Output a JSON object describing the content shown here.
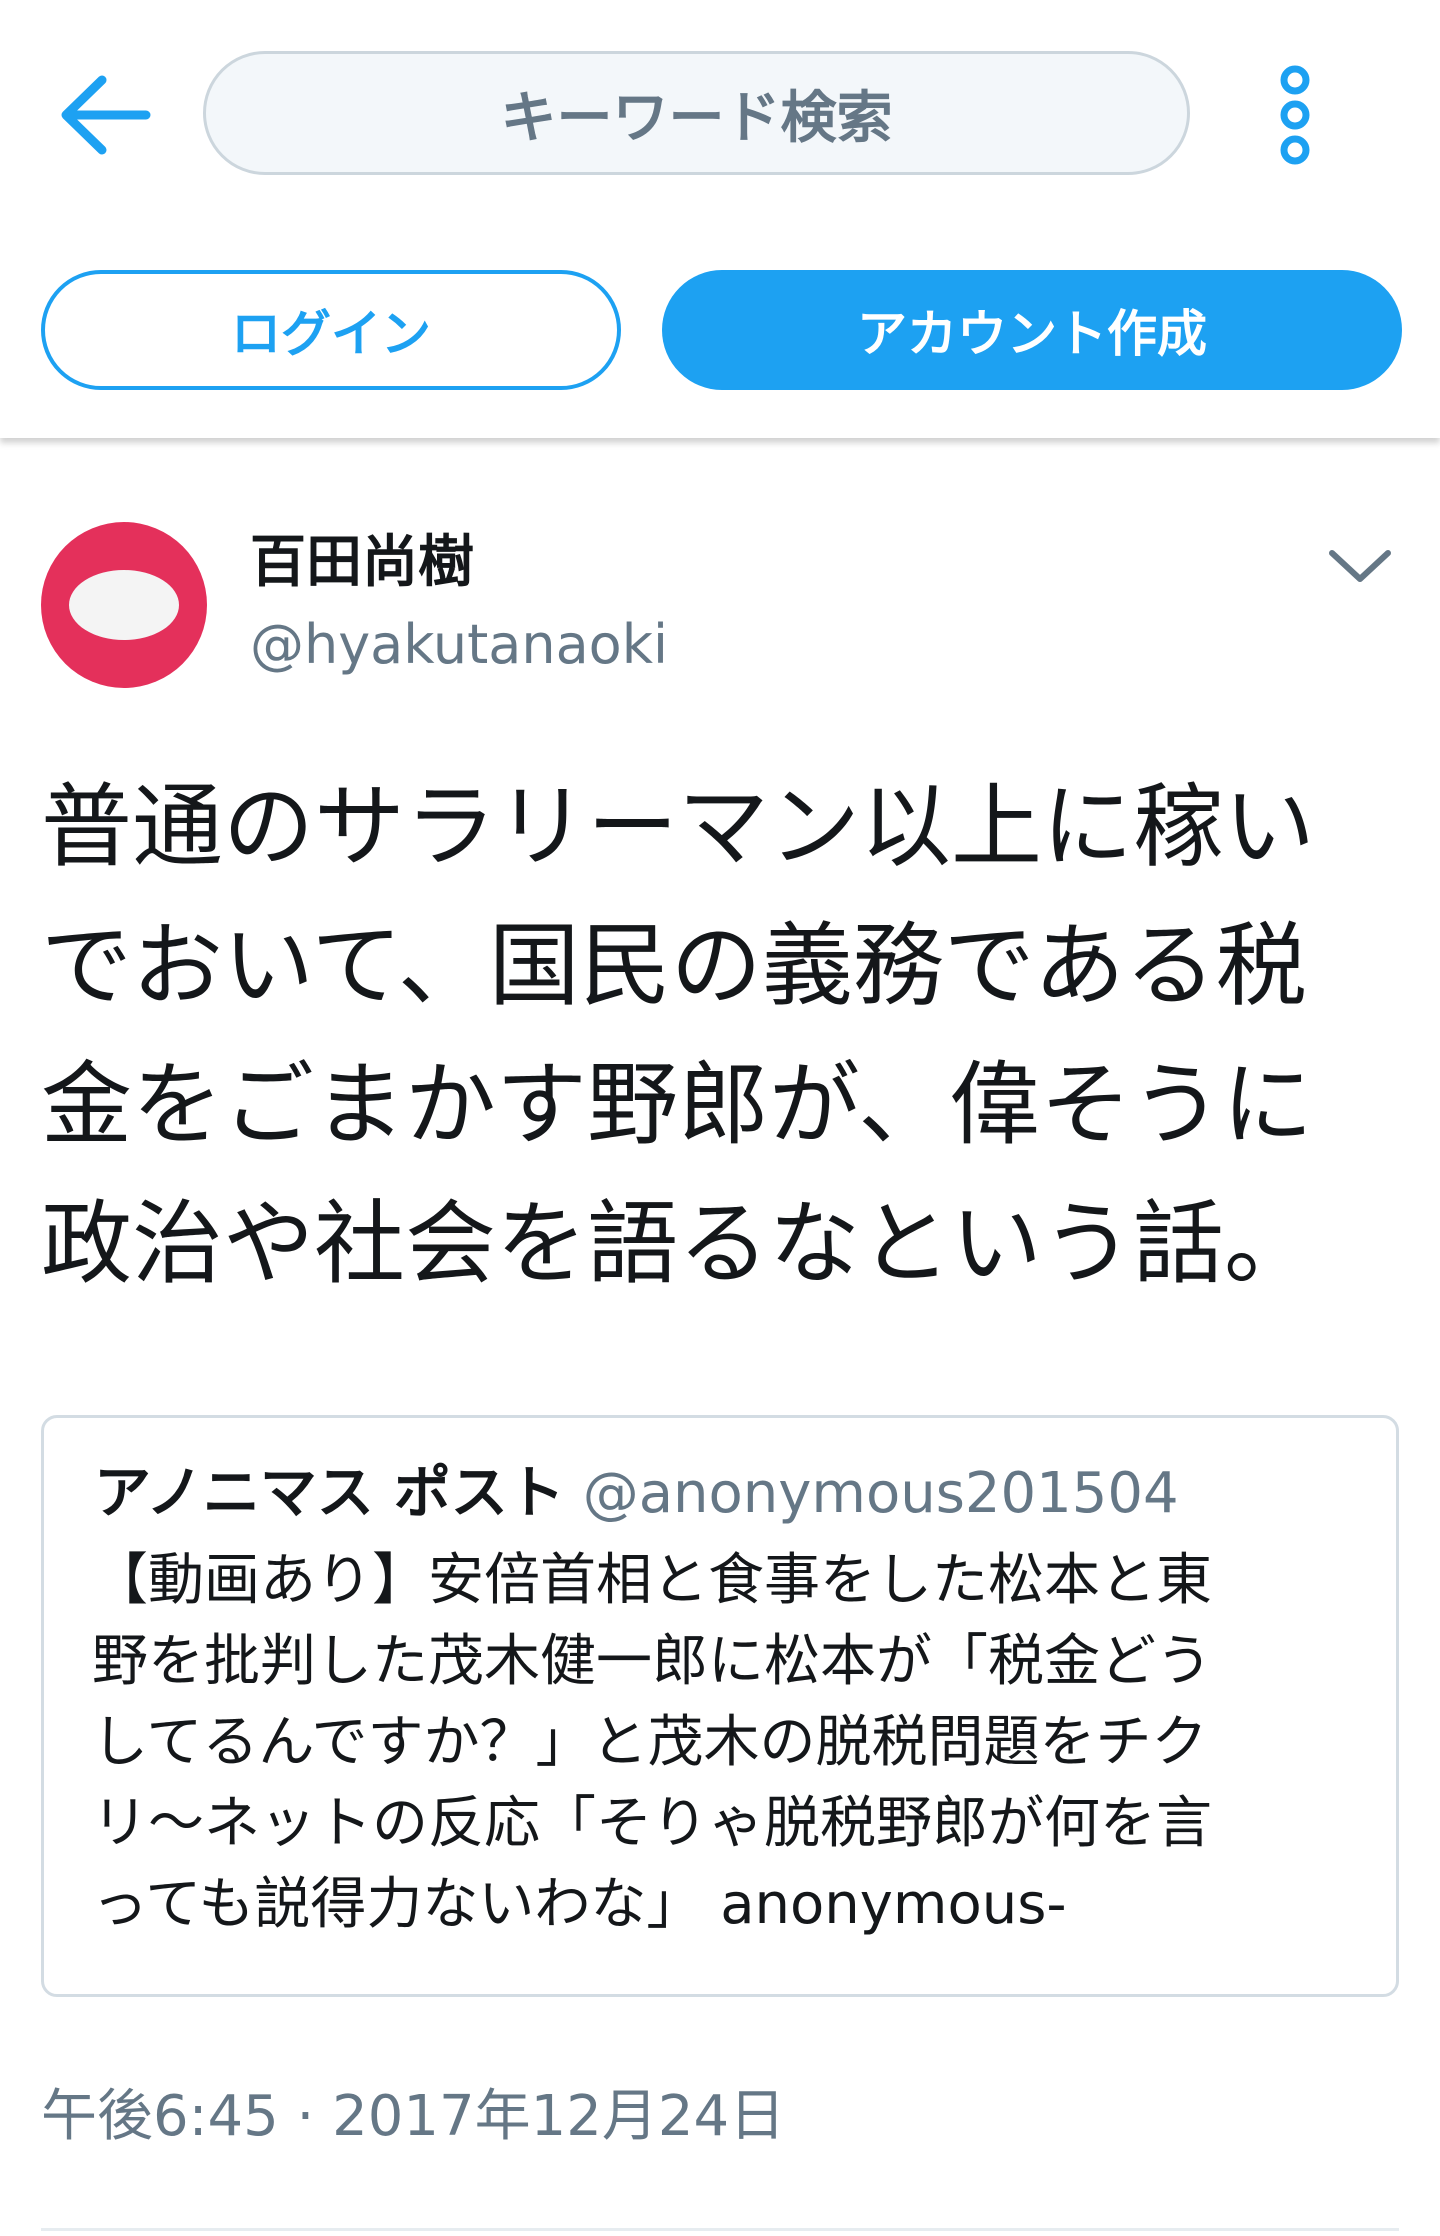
{
  "colors": {
    "accent": "#1da1f2",
    "text": "#14171a",
    "secondary_text": "#657786",
    "avatar": "#e4305b",
    "border": "#ccd6dd"
  },
  "header": {
    "back_icon": "arrow-left-icon",
    "search": {
      "placeholder": "キーワード検索"
    },
    "more_icon": "more-vertical-icon",
    "login_label": "ログイン",
    "signup_label": "アカウント作成"
  },
  "tweet": {
    "display_name": "百田尚樹",
    "username": "@hyakutanaoki",
    "caret_icon": "chevron-down-icon",
    "text": "普通のサラリーマン以上に稼い\nでおいて、国民の義務である税\n金をごまかす野郎が、偉そうに\n政治や社会を語るなという話。",
    "quote": {
      "name": "アノニマス ポスト",
      "handle": "@anonymous201504",
      "text": "【動画あり】安倍首相と食事をした松本と東\n野を批判した茂木健一郎に松本が「税金どう\nしてるんですか？」と茂木の脱税問題をチク\nリ～ネットの反応「そりゃ脱税野郎が何を言\nっても説得力ないわな」 anonymous-"
    },
    "timestamp": "午後6:45 · 2017年12月24日"
  }
}
